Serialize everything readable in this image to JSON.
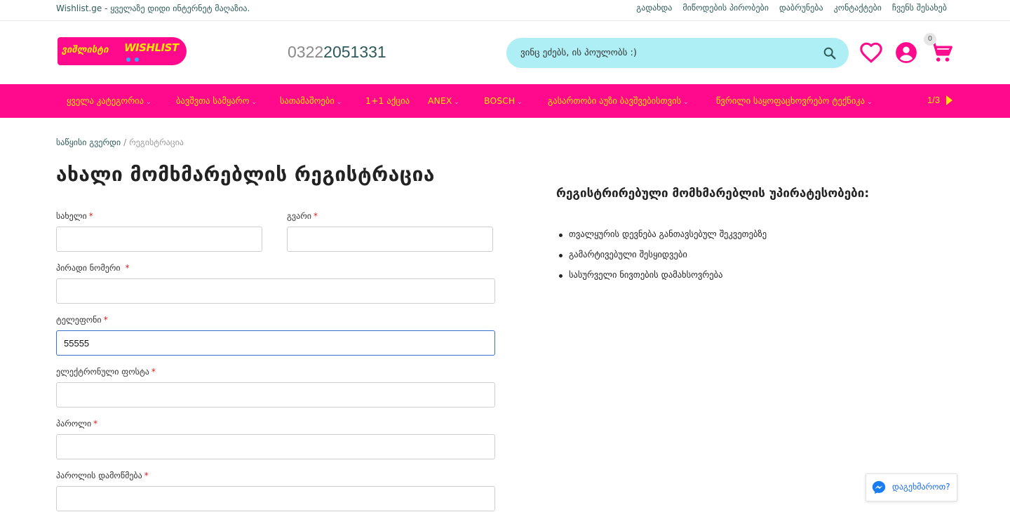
{
  "topbar": {
    "tagline": "Wishlist.ge - ყველაზე დიდი ინტერნეტ მაღაზია.",
    "links": [
      "გადახდა",
      "მიწოდების პირობები",
      "დაბრუნება",
      "კონტაქტები",
      "ჩვენს შესახებ"
    ]
  },
  "header": {
    "logo_geo": "ვიშლისტი",
    "logo_text": "WISHLIST",
    "phone_prefix": "0322",
    "phone_number": "051331",
    "phone_digit": "2",
    "search_placeholder": "ვინც ეძებს, ის პოულობს :)",
    "cart_count": "0"
  },
  "nav": {
    "items": [
      {
        "label": "ყველა კატეგორია",
        "dropdown": true
      },
      {
        "label": "ბავშვთა სამყარო",
        "dropdown": true
      },
      {
        "label": "სათამაშოები",
        "dropdown": true
      },
      {
        "label": "1+1 აქცია",
        "dropdown": false
      },
      {
        "label": "ANEX",
        "dropdown": true
      },
      {
        "label": "BOSCH",
        "dropdown": true
      },
      {
        "label": "გასართობი აუზი ბავშვებისთვის",
        "dropdown": true
      },
      {
        "label": "წვრილი საყოფაცხოვრებო ტექნიკა",
        "dropdown": true
      }
    ],
    "pager": "1/3",
    "chevron": "⌄"
  },
  "breadcrumb": {
    "home": "საწყისი გვერდი",
    "separator": "/",
    "current": "რეგისტრაცია"
  },
  "page_title": "ახალი მომხმარებლის რეგისტრაცია",
  "form": {
    "required_mark": "*",
    "first_name_label": "სახელი",
    "last_name_label": "გვარი",
    "personal_id_label": "პირადი ნომერი ",
    "phone_label": "ტელეფონი",
    "phone_value": "55555",
    "email_label": "ელექტრონული ფოსტა",
    "password_label": "პაროლი",
    "password_confirm_label": "პაროლის დამოწმება"
  },
  "benefits": {
    "title": "რეგისტრირებული მომხმარებლის უპირატესობები:",
    "items": [
      "თვალყურის დევნება განთავსებულ შეკვეთებზე",
      "გამარტივებული შესყიდვები",
      "სასურველი ნივთების დამახსოვრება"
    ]
  },
  "chat": {
    "label": "დაგეხმაროთ?"
  },
  "colors": {
    "brand_pink": "#ff0a8c",
    "brand_yellow": "#ffe600",
    "search_bg": "#aeeef5",
    "accent_teal": "#2f5a5a"
  }
}
